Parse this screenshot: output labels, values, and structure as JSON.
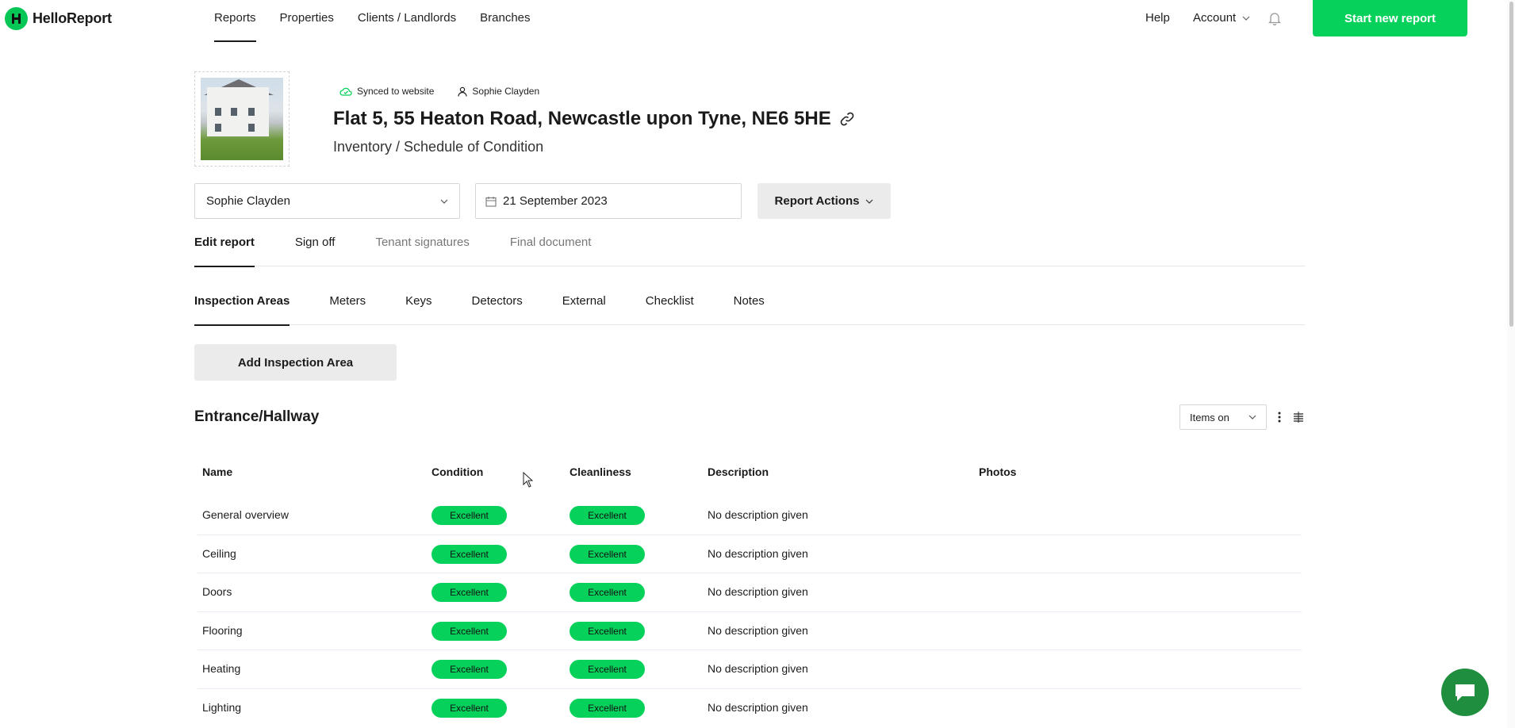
{
  "app": {
    "name": "HelloReport"
  },
  "nav": {
    "items": [
      "Reports",
      "Properties",
      "Clients / Landlords",
      "Branches"
    ],
    "active": "Reports"
  },
  "topRight": {
    "help": "Help",
    "account": "Account",
    "start_button": "Start new report"
  },
  "header": {
    "sync_status": "Synced to website",
    "assignee": "Sophie Clayden",
    "address": "Flat 5, 55 Heaton Road, Newcastle upon Tyne, NE6 5HE",
    "report_type": "Inventory / Schedule of Condition"
  },
  "controls": {
    "clerk_select": "Sophie Clayden",
    "date": "21 September 2023",
    "report_actions": "Report Actions"
  },
  "tabs": [
    "Edit report",
    "Sign off",
    "Tenant signatures",
    "Final document"
  ],
  "subtabs": [
    "Inspection Areas",
    "Meters",
    "Keys",
    "Detectors",
    "External",
    "Checklist",
    "Notes"
  ],
  "add_area_button": "Add Inspection Area",
  "section": {
    "title": "Entrance/Hallway",
    "items_select": "Items on",
    "columns": [
      "Name",
      "Condition",
      "Cleanliness",
      "Description",
      "Photos"
    ],
    "rows": [
      {
        "name": "General overview",
        "condition": "Excellent",
        "cleanliness": "Excellent",
        "description": "No description given"
      },
      {
        "name": "Ceiling",
        "condition": "Excellent",
        "cleanliness": "Excellent",
        "description": "No description given"
      },
      {
        "name": "Doors",
        "condition": "Excellent",
        "cleanliness": "Excellent",
        "description": "No description given"
      },
      {
        "name": "Flooring",
        "condition": "Excellent",
        "cleanliness": "Excellent",
        "description": "No description given"
      },
      {
        "name": "Heating",
        "condition": "Excellent",
        "cleanliness": "Excellent",
        "description": "No description given"
      },
      {
        "name": "Lighting",
        "condition": "Excellent",
        "cleanliness": "Excellent",
        "description": "No description given"
      }
    ]
  },
  "colors": {
    "brand": "#06d15b",
    "badge": "#06d15b",
    "chat": "#1f8f3f"
  }
}
